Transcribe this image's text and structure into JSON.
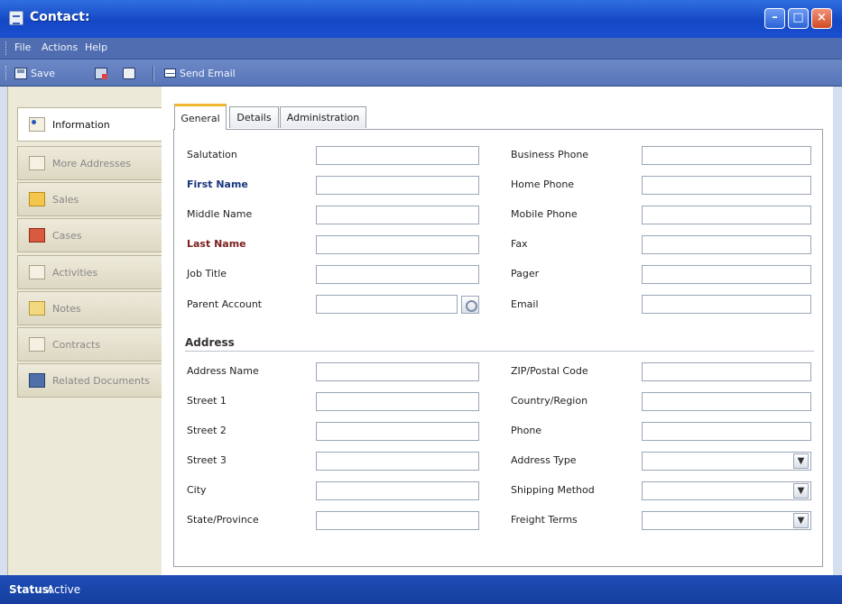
{
  "window": {
    "title": "Contact:"
  },
  "menu": {
    "file": "File",
    "actions": "Actions",
    "help": "Help"
  },
  "toolbar": {
    "save": "Save",
    "send_email": "Send Email"
  },
  "nav": {
    "items": [
      {
        "label": "Information",
        "icon": "information-icon",
        "active": true
      },
      {
        "label": "More Addresses",
        "icon": "address-icon"
      },
      {
        "label": "Sales",
        "icon": "sales-icon"
      },
      {
        "label": "Cases",
        "icon": "cases-icon"
      },
      {
        "label": "Activities",
        "icon": "activities-icon"
      },
      {
        "label": "Notes",
        "icon": "notes-icon"
      },
      {
        "label": "Contracts",
        "icon": "contracts-icon"
      },
      {
        "label": "Related Documents",
        "icon": "related-documents-icon"
      }
    ]
  },
  "tabs": {
    "general": "General",
    "details": "Details",
    "administration": "Administration"
  },
  "form": {
    "salutation": "Salutation",
    "first_name": "First Name",
    "middle_name": "Middle Name",
    "last_name": "Last Name",
    "job_title": "Job Title",
    "parent_account": "Parent Account",
    "business_phone": "Business Phone",
    "home_phone": "Home Phone",
    "mobile_phone": "Mobile Phone",
    "fax": "Fax",
    "pager": "Pager",
    "email": "Email"
  },
  "address": {
    "title": "Address",
    "address_name": "Address Name",
    "street1": "Street 1",
    "street2": "Street 2",
    "street3": "Street 3",
    "city": "City",
    "state_province": "State/Province",
    "zip_postal_code": "ZIP/Postal Code",
    "country_region": "Country/Region",
    "phone": "Phone",
    "address_type": "Address Type",
    "shipping_method": "Shipping Method",
    "freight_terms": "Freight Terms"
  },
  "status": {
    "label": "Status:",
    "value": "Active"
  },
  "colors": {
    "titlebar": "#1547C4",
    "toolbar": "#5775B8",
    "status_bar": "#1E4DB6",
    "required_blue": "#17357A",
    "required_red": "#7B1E1E"
  }
}
